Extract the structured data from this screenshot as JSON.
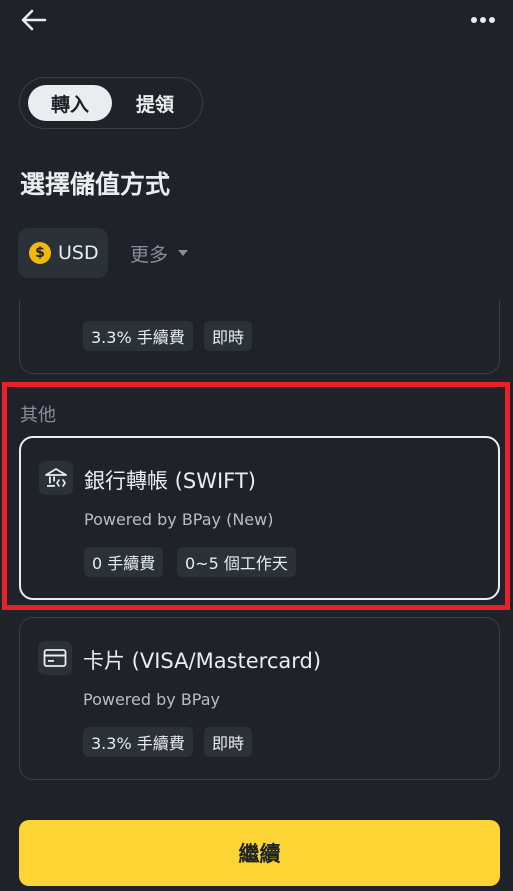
{
  "topbar": {
    "back_icon": "arrow-left-icon",
    "more_icon": "more-horizontal-icon"
  },
  "tabs": [
    {
      "label": "轉入",
      "active": true
    },
    {
      "label": "提領",
      "active": false
    }
  ],
  "section_title": "選擇儲值方式",
  "currency": {
    "symbol": "$",
    "code": "USD",
    "more_label": "更多"
  },
  "partial_card": {
    "tags": [
      "3.3% 手續費",
      "即時"
    ]
  },
  "group_label": "其他",
  "methods": [
    {
      "title": "銀行轉帳 (SWIFT)",
      "subtitle": "Powered by BPay (New)",
      "tags": [
        "0 手續費",
        "0~5 個工作天"
      ],
      "icon": "bank-transfer-icon",
      "selected": true
    },
    {
      "title": "卡片 (VISA/Mastercard)",
      "subtitle": "Powered by BPay",
      "tags": [
        "3.3% 手續費",
        "即時"
      ],
      "icon": "credit-card-icon",
      "selected": false
    }
  ],
  "continue_label": "繼續",
  "colors": {
    "background": "#1f2329",
    "accent_yellow": "#fcd535",
    "coin_gold": "#f0b90b",
    "highlight_red": "#e8202a"
  }
}
